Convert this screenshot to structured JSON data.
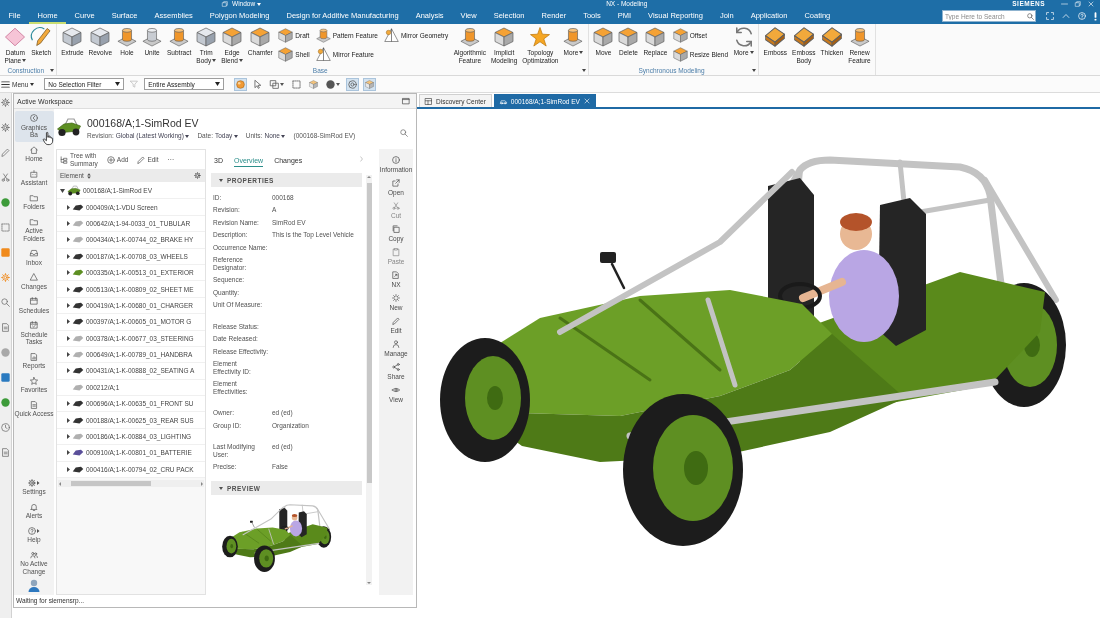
{
  "title_bar": {
    "menu": "Window",
    "title": "NX - Modeling",
    "brand": "SIEMENS"
  },
  "ribbon_tabs": [
    {
      "label": "File",
      "selected": false
    },
    {
      "label": "Home",
      "selected": true
    },
    {
      "label": "Curve",
      "selected": false
    },
    {
      "label": "Surface",
      "selected": false
    },
    {
      "label": "Assemblies",
      "selected": false
    },
    {
      "label": "Polygon Modeling",
      "selected": false
    },
    {
      "label": "Design for Additive Manufacturing",
      "selected": false
    },
    {
      "label": "Analysis",
      "selected": false
    },
    {
      "label": "View",
      "selected": false
    },
    {
      "label": "Selection",
      "selected": false
    },
    {
      "label": "Render",
      "selected": false
    },
    {
      "label": "Tools",
      "selected": false
    },
    {
      "label": "PMI",
      "selected": false
    },
    {
      "label": "Visual Reporting",
      "selected": false
    },
    {
      "label": "Join",
      "selected": false
    },
    {
      "label": "Application",
      "selected": false
    },
    {
      "label": "Coating",
      "selected": false
    }
  ],
  "search": {
    "placeholder": "Type Here to Search"
  },
  "ribbon_groups": [
    {
      "label": "Construction",
      "menu": true,
      "columns": [
        {
          "kind": "large",
          "label": "Datum\nPlane",
          "menu": true
        },
        {
          "kind": "large",
          "label": "Sketch",
          "menu": false
        }
      ]
    },
    {
      "label": "Base",
      "menu": true,
      "columns": [
        {
          "kind": "large",
          "label": "Extrude",
          "menu": false
        },
        {
          "kind": "large",
          "label": "Revolve",
          "menu": false
        },
        {
          "kind": "large",
          "label": "Hole",
          "menu": false
        },
        {
          "kind": "large",
          "label": "Unite",
          "menu": false
        },
        {
          "kind": "large",
          "label": "Subtract",
          "menu": false
        },
        {
          "kind": "large",
          "label": "Trim\nBody",
          "menu": true
        },
        {
          "kind": "large",
          "label": "Edge\nBlend",
          "menu": true
        },
        {
          "kind": "large",
          "label": "Chamfer",
          "menu": false
        },
        {
          "kind": "stack",
          "items": [
            {
              "label": "Draft"
            },
            {
              "label": "Shell"
            }
          ]
        },
        {
          "kind": "stack",
          "items": [
            {
              "label": "Pattern Feature"
            },
            {
              "label": "Mirror Feature"
            }
          ]
        },
        {
          "kind": "stack",
          "items": [
            {
              "label": "Mirror Geometry"
            }
          ]
        },
        {
          "kind": "large",
          "label": "Algorithmic\nFeature",
          "menu": false
        },
        {
          "kind": "large",
          "label": "Implicit\nModeling",
          "menu": false
        },
        {
          "kind": "large",
          "label": "Topology\nOptimization",
          "menu": false
        },
        {
          "kind": "large",
          "label": "More",
          "menu": true
        }
      ]
    },
    {
      "label": "Synchronous Modeling",
      "menu": true,
      "columns": [
        {
          "kind": "large",
          "label": "Move",
          "menu": false
        },
        {
          "kind": "large",
          "label": "Delete",
          "menu": false
        },
        {
          "kind": "large",
          "label": "Replace",
          "menu": false
        },
        {
          "kind": "stack",
          "items": [
            {
              "label": "Offset"
            },
            {
              "label": "Resize Blend"
            }
          ]
        },
        {
          "kind": "large",
          "label": "More",
          "menu": true
        }
      ]
    },
    {
      "columns": [
        {
          "kind": "large",
          "label": "Emboss",
          "menu": false
        },
        {
          "kind": "large",
          "label": "Emboss\nBody",
          "menu": false
        },
        {
          "kind": "large",
          "label": "Thicken",
          "menu": false
        },
        {
          "kind": "large",
          "label": "Renew\nFeature",
          "menu": false
        }
      ]
    }
  ],
  "toolbar": {
    "menu": "Menu",
    "selection_filter": "No Selection Filter",
    "filter_button": {
      "disabled": true
    },
    "scope": "Entire Assembly",
    "tools": [
      {
        "on": true,
        "menu": false
      },
      {
        "on": false,
        "menu": false
      },
      {
        "on": false,
        "menu": true
      },
      {
        "on": false,
        "menu": false
      },
      {
        "on": false,
        "menu": false
      },
      {
        "on": false,
        "menu": true
      },
      {
        "on": true,
        "menu": false
      },
      {
        "on": true,
        "menu": false
      }
    ]
  },
  "panel": {
    "title": "Active Workspace"
  },
  "nav": {
    "items": [
      {
        "label": "Graphics\nBa",
        "selected": true
      },
      {
        "label": "Home",
        "selected": false
      },
      {
        "label": "Assistant",
        "selected": false
      },
      {
        "label": "Folders",
        "selected": false
      },
      {
        "label": "Active\nFolders",
        "selected": false
      },
      {
        "label": "Inbox",
        "selected": false
      },
      {
        "label": "Changes",
        "selected": false
      },
      {
        "label": "Schedules",
        "selected": false
      },
      {
        "label": "Schedule\nTasks",
        "selected": false
      },
      {
        "label": "Reports",
        "selected": false
      },
      {
        "label": "Favorites",
        "selected": false
      },
      {
        "label": "Quick Access",
        "selected": false
      }
    ],
    "bottom": [
      {
        "label": "Settings",
        "menu": true
      },
      {
        "label": "Alerts",
        "menu": false
      },
      {
        "label": "Help",
        "menu": true
      },
      {
        "label": "No Active\nChange",
        "menu": false
      }
    ]
  },
  "object": {
    "title": "000168/A;1-SimRod EV",
    "fields": [
      {
        "label": "Revision:",
        "value": "Global (Latest Working)"
      },
      {
        "label": "Date:",
        "value": "Today"
      },
      {
        "label": "Units:",
        "value": "None"
      }
    ],
    "context": "(000168-SimRod EV)"
  },
  "tree_toolbar": [
    {
      "label": "Tree with\nSummary"
    },
    {
      "label": "Add"
    },
    {
      "label": "Edit"
    },
    {
      "label": "···"
    }
  ],
  "tree": {
    "column": "Element",
    "root": {
      "label": "000168/A;1-SimRod EV",
      "expandable": true,
      "expanded": true,
      "children": [
        {
          "label": "000409/A;1-VDU Screen",
          "expandable": true,
          "expanded": false
        },
        {
          "label": "000642/A;1-94-0033_01_TUBULAR",
          "expandable": true,
          "expanded": false
        },
        {
          "label": "000434/A;1-K-00744_02_BRAKE HY",
          "expandable": true,
          "expanded": false
        },
        {
          "label": "000187/A;1-K-00708_03_WHEELS",
          "expandable": true,
          "expanded": false
        },
        {
          "label": "000335/A;1-K-00513_01_EXTERIOR",
          "expandable": true,
          "expanded": false
        },
        {
          "label": "000513/A;1-K-00809_02_SHEET ME",
          "expandable": true,
          "expanded": false
        },
        {
          "label": "000419/A;1-K-00680_01_CHARGER",
          "expandable": true,
          "expanded": false
        },
        {
          "label": "000397/A;1-K-00605_01_MOTOR G",
          "expandable": true,
          "expanded": false
        },
        {
          "label": "000378/A;1-K-00677_03_STEERING",
          "expandable": true,
          "expanded": false
        },
        {
          "label": "000649/A;1-K-00789_01_HANDBRA",
          "expandable": true,
          "expanded": false
        },
        {
          "label": "000431/A;1-K-00888_02_SEATING A",
          "expandable": true,
          "expanded": false
        },
        {
          "label": "000212/A;1",
          "expandable": false
        },
        {
          "label": "000696/A;1-K-00635_01_FRONT SU",
          "expandable": true,
          "expanded": false
        },
        {
          "label": "000188/A;1-K-00625_03_REAR SUS",
          "expandable": true,
          "expanded": false
        },
        {
          "label": "000186/A;1-K-00884_03_LIGHTING",
          "expandable": true,
          "expanded": false
        },
        {
          "label": "000910/A;1-K-00801_01_BATTERIE",
          "expandable": true,
          "expanded": false
        },
        {
          "label": "000416/A;1-K-00794_02_CRU PACK",
          "expandable": true,
          "expanded": false
        }
      ]
    }
  },
  "details_tabs": [
    {
      "label": "3D",
      "selected": false
    },
    {
      "label": "Overview",
      "selected": true
    },
    {
      "label": "Changes",
      "selected": false
    }
  ],
  "properties": {
    "title": "PROPERTIES",
    "expanded": true,
    "groups": [
      [
        {
          "label": "ID:",
          "value": "000168"
        },
        {
          "label": "Revision:",
          "value": "A"
        },
        {
          "label": "Revision Name:",
          "value": "SimRod EV"
        },
        {
          "label": "Description:",
          "value": "This is the Top Level Vehicle"
        },
        {
          "label": "Occurrence Name:"
        },
        {
          "label": "Reference\nDesignator:"
        },
        {
          "label": "Sequence:"
        },
        {
          "label": "Quantity:"
        },
        {
          "label": "Unit Of Measure:"
        }
      ],
      [
        {
          "label": "Release Status:"
        },
        {
          "label": "Date Released:"
        },
        {
          "label": "Release Effectivity:"
        },
        {
          "label": "Element\nEffectivity ID:"
        },
        {
          "label": "Element\nEffectivities:"
        }
      ],
      [
        {
          "label": "Owner:",
          "value": "ed (ed)"
        },
        {
          "label": "Group ID:",
          "value": "Organization"
        }
      ],
      [
        {
          "label": "Last Modifying\nUser:",
          "value": "ed (ed)"
        },
        {
          "label": "Precise:",
          "value": "False"
        }
      ]
    ]
  },
  "preview": {
    "title": "PREVIEW",
    "expanded": true
  },
  "actions": [
    {
      "label": "Information",
      "disabled": false
    },
    {
      "label": "Open",
      "disabled": false
    },
    {
      "label": "Cut",
      "disabled": true
    },
    {
      "label": "Copy",
      "disabled": false
    },
    {
      "label": "Paste",
      "disabled": true
    },
    {
      "label": "NX",
      "disabled": false
    },
    {
      "label": "New",
      "disabled": false
    },
    {
      "label": "Edit",
      "disabled": false
    },
    {
      "label": "Manage",
      "disabled": false
    },
    {
      "label": "Share",
      "disabled": false
    },
    {
      "label": "View",
      "disabled": false
    }
  ],
  "status": "Waiting for siemensrp...",
  "document_tabs": [
    {
      "label": "Discovery Center",
      "selected": false,
      "closable": false
    },
    {
      "label": "000168/A;1-SimRod EV",
      "selected": true,
      "closable": true
    }
  ]
}
